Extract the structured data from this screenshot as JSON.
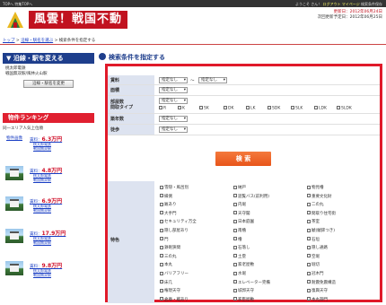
{
  "topbar": {
    "left": "TOPへ  特集TOPへ",
    "right_prefix": "ようこそ",
    "user": "",
    "right_mid": "さん！",
    "logout": "ログアウト",
    "mypage": "マイページ",
    "right_tail": "検索条件保存"
  },
  "header": {
    "logo": "風雲！戦国不動産",
    "updated": "更新日：2012年06月24日",
    "next_update": "次回更新予定日：2012年06月25日"
  },
  "breadcrumb": {
    "top": "トップ",
    "line_select": "沿線・駅名を選ぶ",
    "current": "検索条件を指定する"
  },
  "sidebar": {
    "change_title": "沿線・駅を変える",
    "location_line1": "桃太郎電鉄",
    "location_line2": "戦国無双駅/風林火山駅",
    "change_button": "沿線・駅名を変更",
    "ranking_title": "物件ランキング",
    "ranking_sub": "同一エリア人気上位順",
    "items": [
      {
        "label": "物件画像",
        "rent": "賃料",
        "price": "6.3万円",
        "line1": "桃太郎電鉄",
        "line2": "戦国無双駅"
      },
      {
        "label": "",
        "rent": "賃料",
        "price": "4.8万円",
        "line1": "桃太郎電鉄",
        "line2": "戦国無双駅"
      },
      {
        "label": "",
        "rent": "賃料",
        "price": "6.9万円",
        "line1": "桃太郎電鉄",
        "line2": "戦国無双駅"
      },
      {
        "label": "",
        "rent": "賃料",
        "price": "17.9万円",
        "line1": "桃太郎電鉄",
        "line2": "戦国無双駅"
      },
      {
        "label": "",
        "rent": "賃料",
        "price": "9.8万円",
        "line1": "桃太郎電鉄",
        "line2": "戦国無双駅"
      }
    ]
  },
  "main": {
    "title": "検索条件を指定する",
    "rent_label": "賃料",
    "area_label": "面積",
    "layout_label": "部屋数\n間取タイプ",
    "age_label": "築年数",
    "walk_label": "徒歩",
    "none": "指定なし",
    "tilde": "〜",
    "layouts": [
      "R",
      "K",
      "SK",
      "DK",
      "LK",
      "SDK",
      "SLK",
      "LDK",
      "SLDK"
    ],
    "search_button": "検 索",
    "feature_label": "特色",
    "features_col1": [
      "雪隠・風呂別",
      "縁側",
      "厩あり",
      "大手門",
      "セキュリティ万全",
      "隠し部屋あり",
      "門",
      "鉄砲狭間",
      "三の丸",
      "本丸",
      "バリアフリー",
      "床几",
      "権現天守",
      "倉庫・蔵あり"
    ],
    "features_col2": [
      "納戸",
      "遊覧バス(前利用)",
      "内堀",
      "天守閣",
      "日本庭園",
      "南櫓",
      "櫓",
      "石落し",
      "土塁",
      "家老屋敷",
      "水堀",
      "エレベーター完備",
      "城郭天守",
      "家臣屋敷"
    ],
    "features_col3": [
      "物見櫓",
      "重要文化財",
      "二の丸",
      "間取り住宅街",
      "茶室",
      "鯱(鯱鉾つき)",
      "石垣",
      "隠し通路",
      "空堀",
      "堀切",
      "冠木門",
      "耐震免震構造",
      "復興天守",
      "本丸御門"
    ]
  }
}
